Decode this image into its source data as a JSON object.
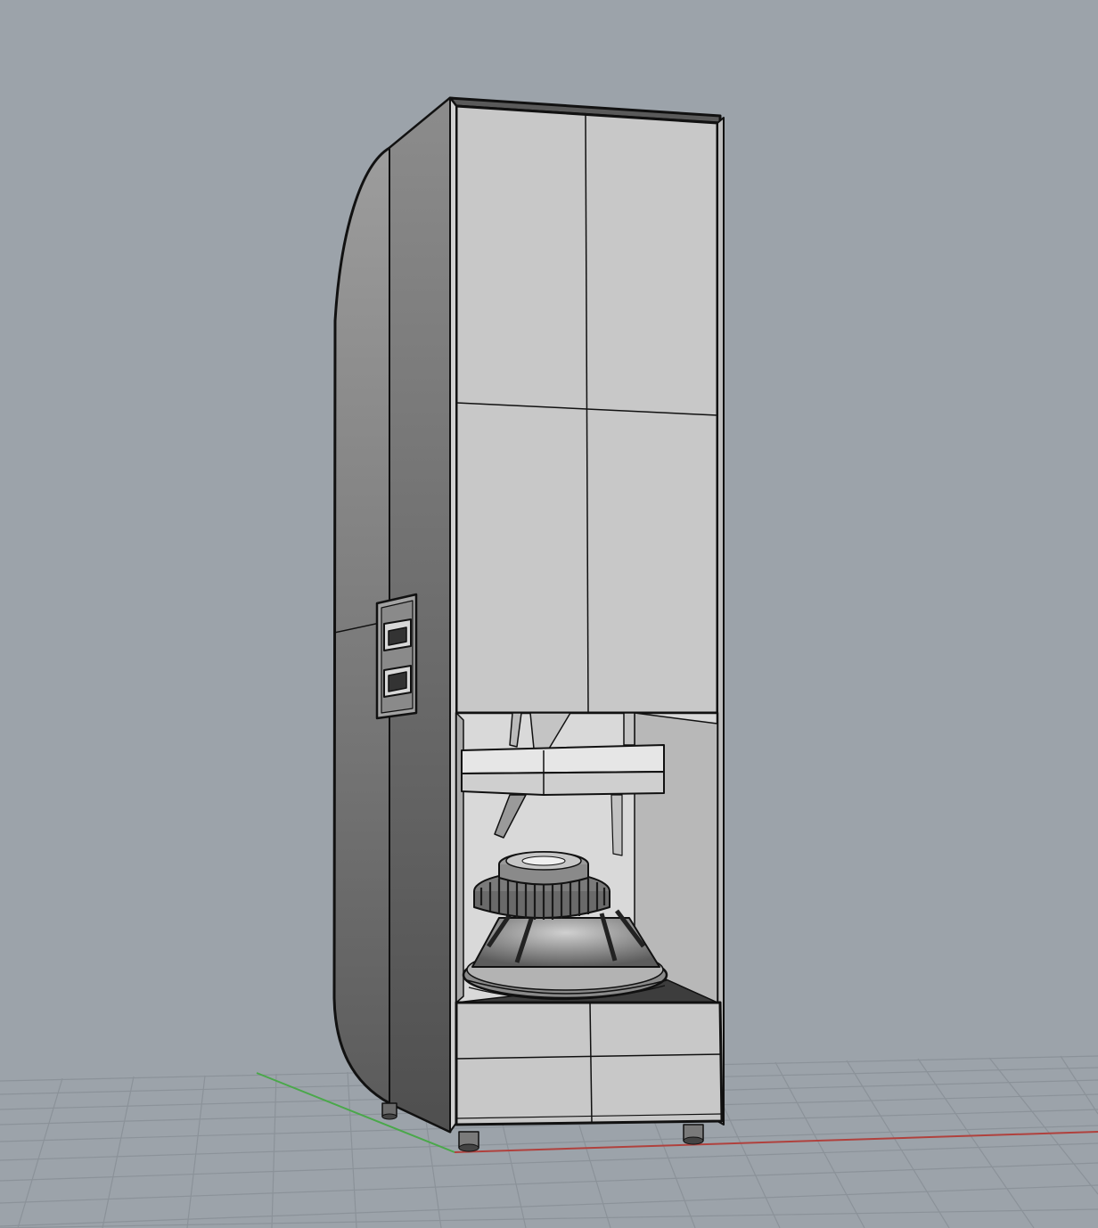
{
  "viewport": {
    "background": "#9ca3aa",
    "grid_color": "#8c939a",
    "x_axis_color": "#b0413d",
    "y_axis_color": "#4aa84a"
  },
  "model": {
    "outline_color": "#111111",
    "front_panel_color": "#c9c9c9",
    "side_gradient_light": "#9a9a9a",
    "side_gradient_dark": "#5e5e5e",
    "cavity_color": "#dcdcdc",
    "driver_color": "#6f6f6f",
    "icons": [
      "cabinet-body",
      "speaker-driver-icon",
      "connector-socket-icon"
    ]
  }
}
